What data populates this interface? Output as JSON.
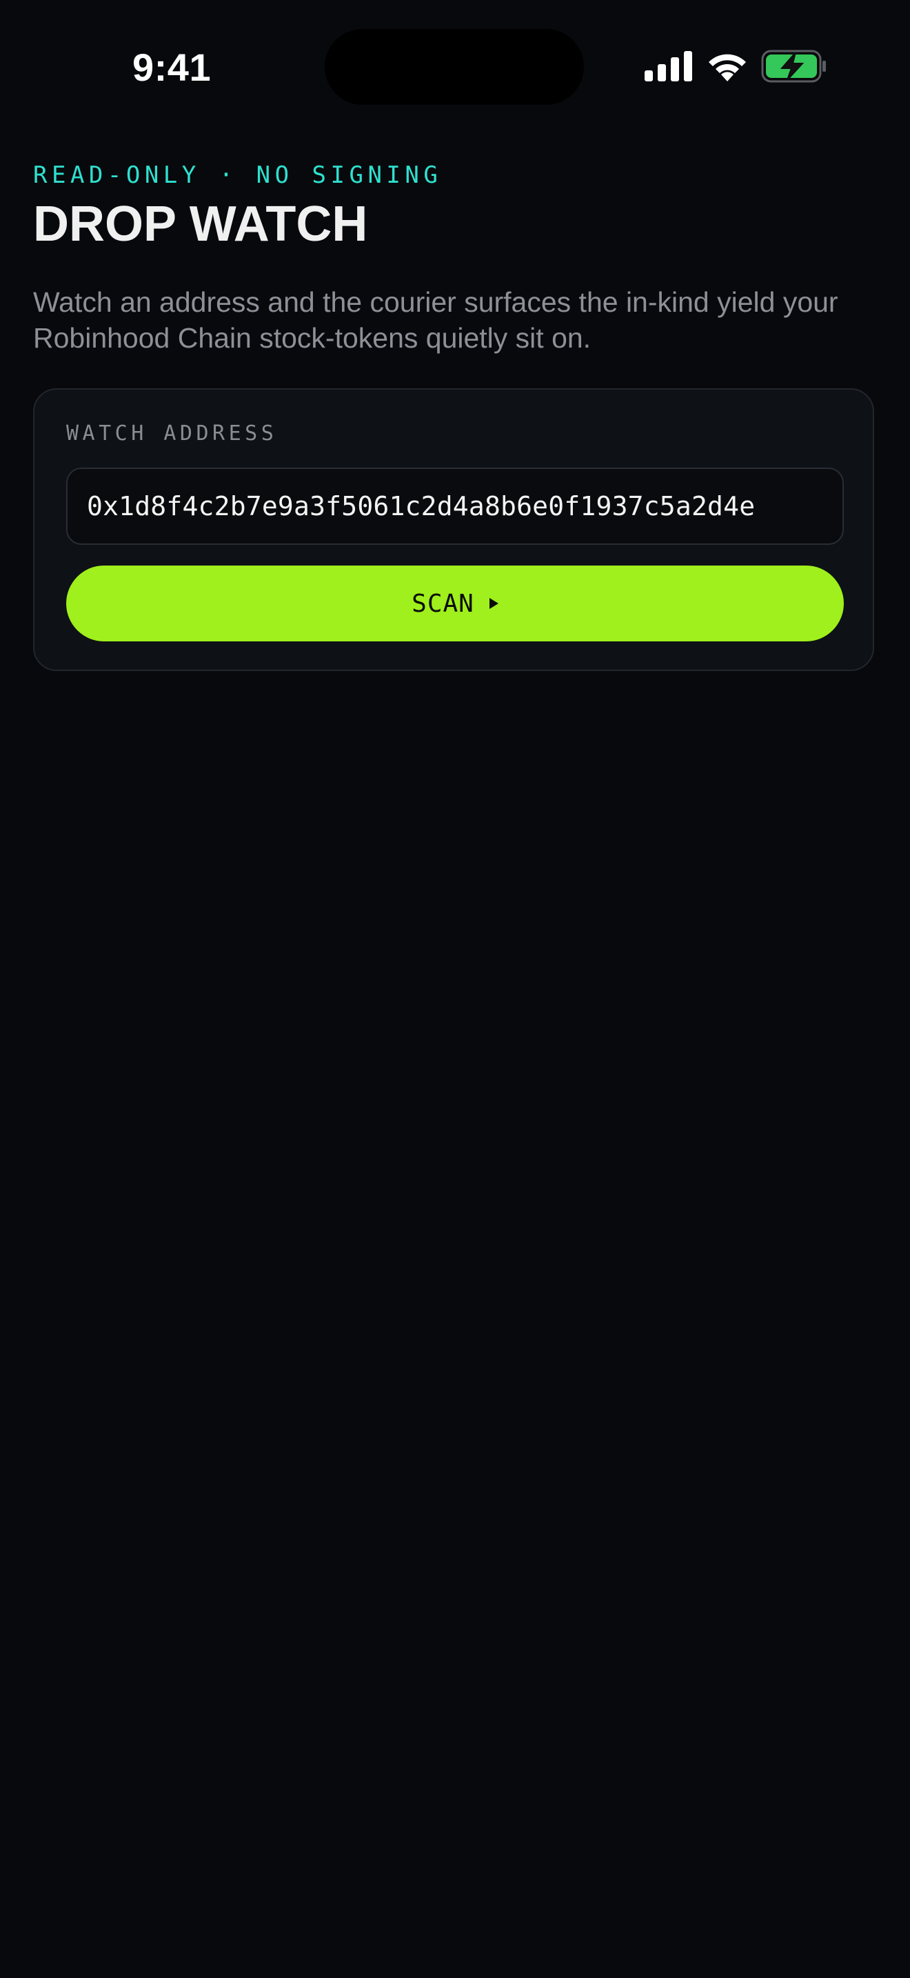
{
  "status_bar": {
    "time": "9:41",
    "signal_icon": "cellular-signal-icon",
    "wifi_icon": "wifi-icon",
    "battery_icon": "battery-charging-icon",
    "battery_color": "#34c759"
  },
  "header": {
    "eyebrow": "READ-ONLY · NO SIGNING",
    "title": "DROP WATCH",
    "description": "Watch an address and the courier surfaces the in-kind yield your Robinhood Chain stock-tokens quietly sit on."
  },
  "watch_card": {
    "field_label": "WATCH ADDRESS",
    "address_value": "0x1d8f4c2b7e9a3f5061c2d4a8b6e0f1937c5a2d4e",
    "scan_label": "SCAN",
    "scan_icon": "play-icon"
  },
  "colors": {
    "background": "#08090c",
    "accent_teal": "#2fe0cf",
    "accent_lime": "#9ff01c",
    "card": "#0e1116"
  }
}
